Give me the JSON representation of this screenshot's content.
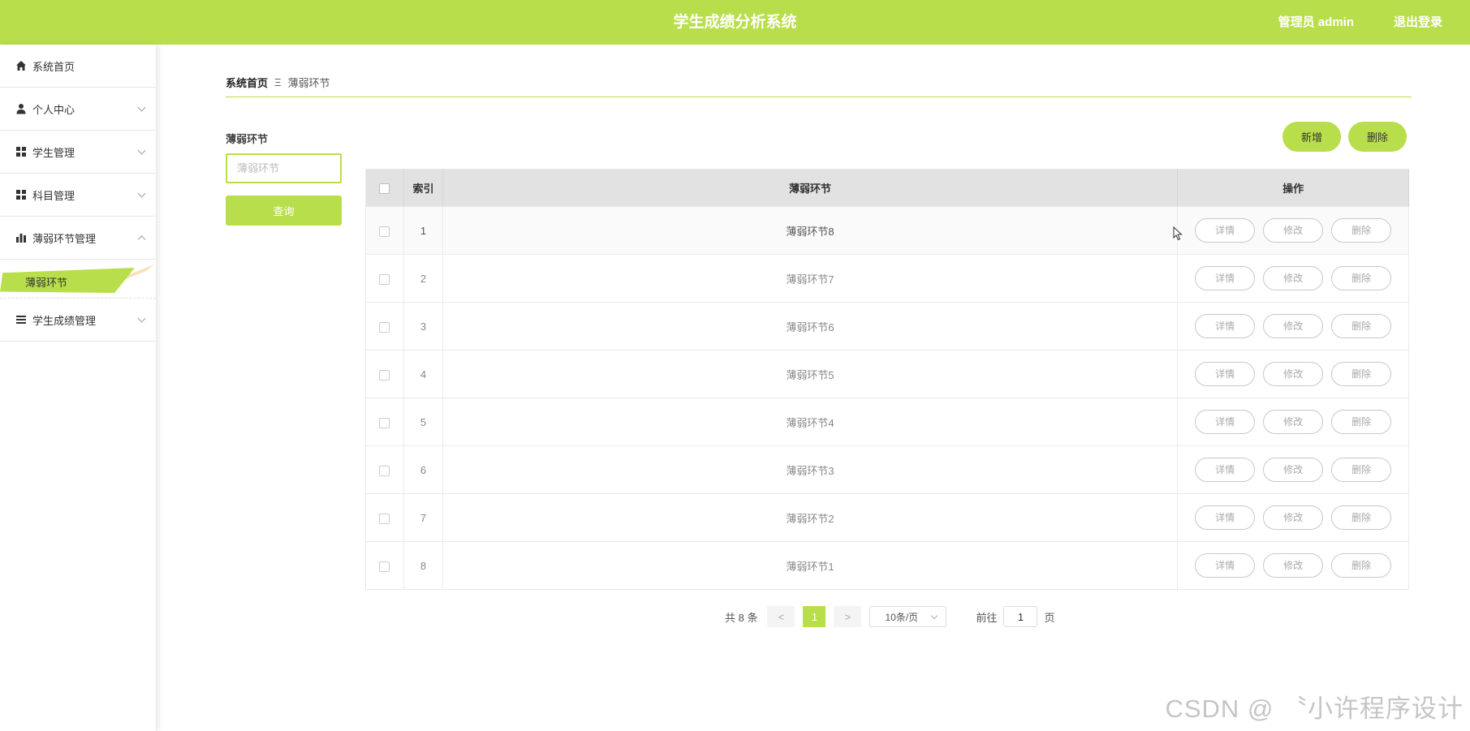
{
  "header": {
    "title": "学生成绩分析系统",
    "user": "管理员 admin",
    "logout": "退出登录"
  },
  "sidebar": {
    "items": [
      {
        "label": "系统首页",
        "icon": "home-icon"
      },
      {
        "label": "个人中心",
        "icon": "user-icon"
      },
      {
        "label": "学生管理",
        "icon": "grid-icon"
      },
      {
        "label": "科目管理",
        "icon": "grid-icon"
      },
      {
        "label": "薄弱环节管理",
        "icon": "bar-chart-icon"
      },
      {
        "label": "学生成绩管理",
        "icon": "list-icon"
      }
    ],
    "active_sub": "薄弱环节"
  },
  "breadcrumb": {
    "home": "系统首页",
    "sep": "Ξ",
    "current": "薄弱环节"
  },
  "search": {
    "label": "薄弱环节",
    "placeholder": "薄弱环节",
    "button": "查询"
  },
  "actions": {
    "add": "新增",
    "delete": "删除"
  },
  "table": {
    "headers": {
      "index": "索引",
      "name": "薄弱环节",
      "ops": "操作"
    },
    "ops": {
      "detail": "详情",
      "edit": "修改",
      "delete": "删除"
    },
    "rows": [
      {
        "index": "1",
        "name": "薄弱环节8"
      },
      {
        "index": "2",
        "name": "薄弱环节7"
      },
      {
        "index": "3",
        "name": "薄弱环节6"
      },
      {
        "index": "4",
        "name": "薄弱环节5"
      },
      {
        "index": "5",
        "name": "薄弱环节4"
      },
      {
        "index": "6",
        "name": "薄弱环节3"
      },
      {
        "index": "7",
        "name": "薄弱环节2"
      },
      {
        "index": "8",
        "name": "薄弱环节1"
      }
    ]
  },
  "pagination": {
    "total": "共 8 条",
    "prev": "<",
    "page": "1",
    "next": ">",
    "size": "10条/页",
    "goto": "前往",
    "goto_value": "1",
    "unit": "页"
  },
  "watermark": "CSDN @ 〝小许程序设计",
  "colors": {
    "accent": "#b9de4b"
  }
}
